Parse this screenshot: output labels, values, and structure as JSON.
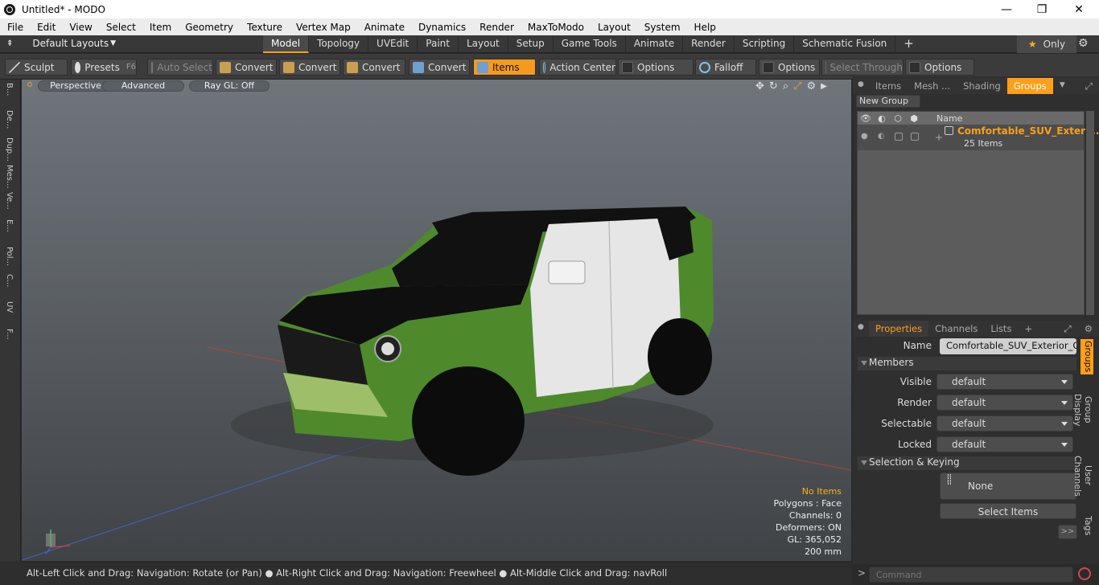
{
  "window": {
    "title": "Untitled* - MODO",
    "minimize": "—",
    "maximize": "❐",
    "close": "✕"
  },
  "menu": [
    "File",
    "Edit",
    "View",
    "Select",
    "Item",
    "Geometry",
    "Texture",
    "Vertex Map",
    "Animate",
    "Dynamics",
    "Render",
    "MaxToModo",
    "Layout",
    "System",
    "Help"
  ],
  "layout": {
    "preset": "Default Layouts",
    "tabs": [
      "Model",
      "Topology",
      "UVEdit",
      "Paint",
      "Layout",
      "Setup",
      "Game Tools",
      "Animate",
      "Render",
      "Scripting",
      "Schematic Fusion"
    ],
    "active_tab": "Model",
    "only_label": "Only"
  },
  "toolbar": {
    "sculpt": "Sculpt",
    "presets": "Presets",
    "presets_key": "F6",
    "auto_select": "Auto Select",
    "convert": "Convert",
    "items": "Items",
    "action_center": "Action Center",
    "options": "Options",
    "falloff": "Falloff",
    "select_through": "Select Through"
  },
  "left_strip": [
    "B...",
    "De...",
    "Dup...",
    "Mes...",
    "Ve...",
    "E...",
    "Pol...",
    "C...",
    "UV",
    "F..."
  ],
  "viewport": {
    "view": "Perspective",
    "shading": "Advanced",
    "raygl": "Ray GL: Off",
    "stats": {
      "selection": "No Items",
      "polygons": "Polygons : Face",
      "channels": "Channels: 0",
      "deformers": "Deformers: ON",
      "gl": "GL: 365,052",
      "grid": "200 mm"
    }
  },
  "statusbar": "Alt-Left Click and Drag: Navigation: Rotate (or Pan) ● Alt-Right Click and Drag: Navigation: Freewheel ● Alt-Middle Click and Drag: navRoll",
  "groups_panel": {
    "tabs": [
      "Items",
      "Mesh ...",
      "Shading",
      "Groups"
    ],
    "active_tab": "Groups",
    "new_group": "New Group",
    "col_name": "Name",
    "group_name": "Comfortable_SUV_Exteri ...",
    "group_count": "25 Items"
  },
  "properties": {
    "tabs": [
      "Properties",
      "Channels",
      "Lists"
    ],
    "active_tab": "Properties",
    "name_label": "Name",
    "name_value": "Comfortable_SUV_Exterior_Only",
    "members_header": "Members",
    "visible_label": "Visible",
    "render_label": "Render",
    "selectable_label": "Selectable",
    "locked_label": "Locked",
    "dropdown_value": "default",
    "sel_keying_header": "Selection & Keying",
    "none_label": "None",
    "select_items": "Select Items",
    "more": ">>",
    "side_tabs": [
      "Groups",
      "Group Display",
      "User Channels",
      "Tags"
    ]
  },
  "command": {
    "placeholder": "Command",
    "prompt": ">"
  },
  "colors": {
    "accent": "#ff9f1a",
    "car_green": "#4e8a2c",
    "car_black": "#111111",
    "car_white": "#e8e8e8"
  }
}
